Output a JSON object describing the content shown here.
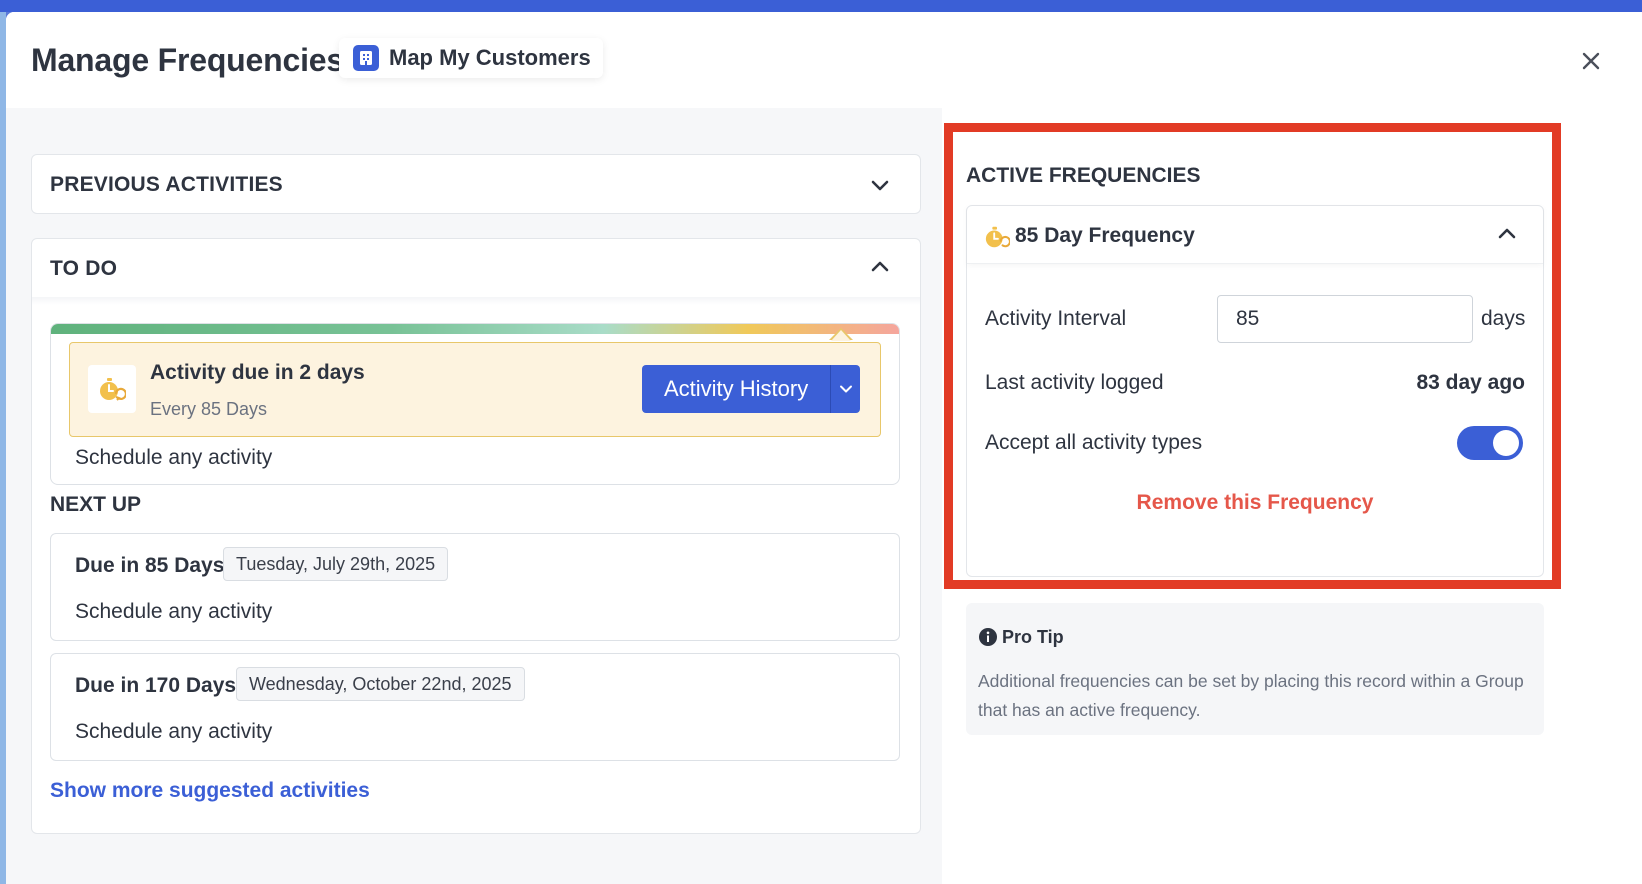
{
  "header": {
    "title": "Manage Frequencies",
    "org_name": "Map My Customers"
  },
  "previous": {
    "heading": "PREVIOUS ACTIVITIES"
  },
  "todo": {
    "heading": "TO DO",
    "due_card": {
      "title": "Activity due in 2 days",
      "subtitle": "Every 85 Days",
      "button_label": "Activity History",
      "schedule_text": "Schedule any activity"
    },
    "next_up": {
      "heading": "NEXT UP",
      "items": [
        {
          "title": "Due in 85 Days",
          "date": "Tuesday, July 29th, 2025",
          "schedule": "Schedule any activity"
        },
        {
          "title": "Due in 170 Days",
          "date": "Wednesday, October 22nd, 2025",
          "schedule": "Schedule any activity"
        }
      ]
    },
    "show_more": "Show more suggested activities"
  },
  "active": {
    "heading": "ACTIVE FREQUENCIES",
    "frequency": {
      "title": "85 Day Frequency",
      "interval_label": "Activity Interval",
      "interval_value": "85",
      "interval_unit": "days",
      "last_label": "Last activity logged",
      "last_value": "83 day ago",
      "accept_label": "Accept all activity types",
      "accept_enabled": true,
      "remove_label": "Remove this Frequency"
    }
  },
  "tip": {
    "title": "Pro Tip",
    "text": "Additional frequencies can be set by placing this record within a Group that has an active frequency."
  },
  "colors": {
    "primary": "#3b5fd6",
    "danger": "#e5574a",
    "highlight_border": "#e23b25",
    "due_bg": "#fdf3df",
    "due_border": "#e8c76a"
  }
}
